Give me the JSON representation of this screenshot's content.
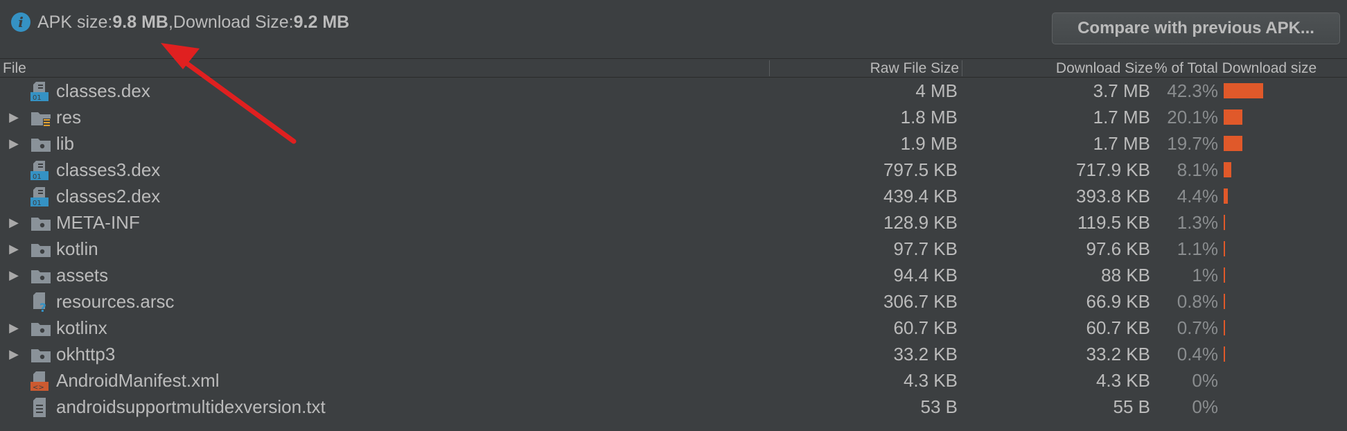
{
  "summary": {
    "apk_label": "APK size: ",
    "apk_value": "9.8 MB",
    "separator": ", ",
    "download_label": "Download Size: ",
    "download_value": "9.2 MB"
  },
  "compare_button": "Compare with previous APK...",
  "columns": {
    "file": "File",
    "raw": "Raw File Size",
    "download": "Download Size",
    "percent": "% of Total Download size"
  },
  "colors": {
    "background": "#3c3f41",
    "bar": "#e0592a",
    "info_icon": "#3592c4",
    "arrow": "#e02020"
  },
  "files": [
    {
      "name": "classes.dex",
      "icon": "dex-file-icon",
      "expandable": false,
      "raw": "4 MB",
      "download": "3.7 MB",
      "percent": "42.3%",
      "share": 0.423
    },
    {
      "name": "res",
      "icon": "res-folder-icon",
      "expandable": true,
      "raw": "1.8 MB",
      "download": "1.7 MB",
      "percent": "20.1%",
      "share": 0.201
    },
    {
      "name": "lib",
      "icon": "folder-icon",
      "expandable": true,
      "raw": "1.9 MB",
      "download": "1.7 MB",
      "percent": "19.7%",
      "share": 0.197
    },
    {
      "name": "classes3.dex",
      "icon": "dex-file-icon",
      "expandable": false,
      "raw": "797.5 KB",
      "download": "717.9 KB",
      "percent": "8.1%",
      "share": 0.081
    },
    {
      "name": "classes2.dex",
      "icon": "dex-file-icon",
      "expandable": false,
      "raw": "439.4 KB",
      "download": "393.8 KB",
      "percent": "4.4%",
      "share": 0.044
    },
    {
      "name": "META-INF",
      "icon": "folder-icon",
      "expandable": true,
      "raw": "128.9 KB",
      "download": "119.5 KB",
      "percent": "1.3%",
      "share": 0.013
    },
    {
      "name": "kotlin",
      "icon": "folder-icon",
      "expandable": true,
      "raw": "97.7 KB",
      "download": "97.6 KB",
      "percent": "1.1%",
      "share": 0.011
    },
    {
      "name": "assets",
      "icon": "folder-icon",
      "expandable": true,
      "raw": "94.4 KB",
      "download": "88 KB",
      "percent": "1%",
      "share": 0.01
    },
    {
      "name": "resources.arsc",
      "icon": "unknown-file-icon",
      "expandable": false,
      "raw": "306.7 KB",
      "download": "66.9 KB",
      "percent": "0.8%",
      "share": 0.008
    },
    {
      "name": "kotlinx",
      "icon": "folder-icon",
      "expandable": true,
      "raw": "60.7 KB",
      "download": "60.7 KB",
      "percent": "0.7%",
      "share": 0.007
    },
    {
      "name": "okhttp3",
      "icon": "folder-icon",
      "expandable": true,
      "raw": "33.2 KB",
      "download": "33.2 KB",
      "percent": "0.4%",
      "share": 0.004
    },
    {
      "name": "AndroidManifest.xml",
      "icon": "xml-file-icon",
      "expandable": false,
      "raw": "4.3 KB",
      "download": "4.3 KB",
      "percent": "0%",
      "share": 0
    },
    {
      "name": "androidsupportmultidexversion.txt",
      "icon": "text-file-icon",
      "expandable": false,
      "raw": "53 B",
      "download": "55 B",
      "percent": "0%",
      "share": 0
    }
  ]
}
